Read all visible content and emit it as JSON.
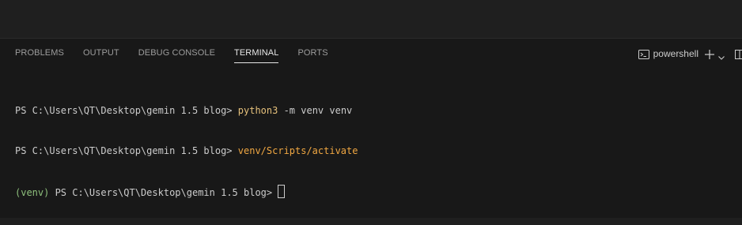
{
  "panel": {
    "tabs": [
      {
        "label": "PROBLEMS",
        "active": false
      },
      {
        "label": "OUTPUT",
        "active": false
      },
      {
        "label": "DEBUG CONSOLE",
        "active": false
      },
      {
        "label": "TERMINAL",
        "active": true
      },
      {
        "label": "PORTS",
        "active": false
      }
    ],
    "actions": {
      "shell_label": "powershell",
      "icons": [
        "terminal-icon",
        "plus-icon",
        "chevron-down-icon",
        "split-panel-icon"
      ]
    }
  },
  "terminal": {
    "lines": [
      {
        "prompt": "PS C:\\Users\\QT\\Desktop\\gemin 1.5 blog> ",
        "command": "python3",
        "args": " -m venv venv"
      },
      {
        "prompt": "PS C:\\Users\\QT\\Desktop\\gemin 1.5 blog> ",
        "command": "venv/Scripts/activate",
        "args": ""
      },
      {
        "env": "(venv)",
        "prompt": " PS C:\\Users\\QT\\Desktop\\gemin 1.5 blog> "
      }
    ]
  },
  "colors": {
    "panel_bg": "#181818",
    "editor_bg": "#1f1f1f",
    "text": "#cccccc",
    "command": "#e5c07b",
    "venv": "#8ec07c",
    "active_tab": "#e7e7e7",
    "inactive_tab": "#9d9d9d"
  }
}
